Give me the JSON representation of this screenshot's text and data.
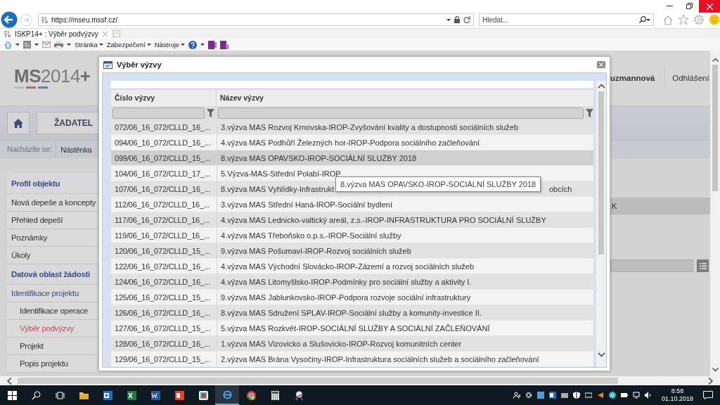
{
  "browser": {
    "url": "https://mseu.mssf.cz/",
    "search_placeholder": "Hledat...",
    "tab_title": "ISKP14+ : Výběr podvýzvy",
    "commands": [
      "Stránka",
      "Zabezpečení",
      "Nástroje"
    ]
  },
  "site": {
    "logo": "**MS**2014**+**",
    "user": "uzmannová",
    "logout": "Odhlášení",
    "role_button": "ŽADATEL",
    "breadcrumb": [
      "Nacházíte se:",
      "Nástěnka"
    ],
    "tab_fragment": "K",
    "sidebar": [
      {
        "label": "Profil objektu",
        "kind": "heading",
        "selected": false
      },
      {
        "label": "Nová depeše a koncepty",
        "kind": "item",
        "selected": false
      },
      {
        "label": "Přehled depeší",
        "kind": "item",
        "selected": false
      },
      {
        "label": "Poznámky",
        "kind": "item",
        "selected": false
      },
      {
        "label": "Úkoly",
        "kind": "item",
        "selected": false
      },
      {
        "label": "Datová oblast žádosti",
        "kind": "heading",
        "selected": false
      },
      {
        "label": "Identifikace projektu",
        "kind": "section",
        "selected": false
      },
      {
        "label": "Identifikace operace",
        "kind": "subitem",
        "selected": false
      },
      {
        "label": "Výběr podvýzvy",
        "kind": "subitem",
        "selected": true
      },
      {
        "label": "Projekt",
        "kind": "subitem",
        "selected": false
      },
      {
        "label": "Popis projektu",
        "kind": "subitem",
        "selected": false
      }
    ]
  },
  "dialog": {
    "title": "Výběr výzvy",
    "columns": [
      "Číslo výzvy",
      "Název výzvy"
    ],
    "tooltip": "8.výzva MAS OPAVSKO-IROP-SOCIÁLNÍ SLUŽBY 2018",
    "rows": [
      {
        "number": "072/06_16_072/CLLD_16_...",
        "name": "3.výzva MAS Rozvoj Krnovska-IROP-Zvyšování kvality a dostupnosti sociálních služeb",
        "selected": false
      },
      {
        "number": "094/06_16_072/CLLD_16_...",
        "name": "4.výzva MAS Podhůří Železných hor-IROP-Podpora sociálního začleňování",
        "selected": false
      },
      {
        "number": "099/06_16_072/CLLD_15_...",
        "name": "8.výzva MAS OPAVSKO-IROP-SOCIÁLNÍ SLUŽBY 2018",
        "selected": true
      },
      {
        "number": "104/06_16_072/CLLD_17_...",
        "name": "5.Výzva-MAS-Střední Polabí-IROP",
        "selected": false
      },
      {
        "number": "107/06_16_072/CLLD_16_...",
        "name": "8.výzva MAS Vyhlídky-Infrastrukt",
        "name_tail": "obcích",
        "selected": false
      },
      {
        "number": "112/06_16_072/CLLD_16_...",
        "name": "3.výzva MAS Střední Haná-IROP-Sociální bydlení",
        "selected": false
      },
      {
        "number": "117/06_16_072/CLLD_16_...",
        "name": "4.výzva MAS Lednicko-valtický areál, z.s.-IROP-INFRASTRUKTURA PRO SOCIÁLNÍ SLUŽBY",
        "selected": false
      },
      {
        "number": "119/06_16_072/CLLD_16_...",
        "name": "4.výzva MAS Třeboňsko o.p.s.-IROP-Sociální služby",
        "selected": false
      },
      {
        "number": "120/06_16_072/CLLD_15_...",
        "name": "9.výzva MAS Pošumaví-IROP-Rozvoj sociálních služeb",
        "selected": false
      },
      {
        "number": "122/06_16_072/CLLD_16_...",
        "name": "4.výzva MAS Východní Slovácko-IROP-Zázemí a rozvoj sociálních služeb",
        "selected": false
      },
      {
        "number": "124/06_16_072/CLLD_16_...",
        "name": "4.výzva MAS Litomyšlsko-IROP-Podmínky pro sociální služby a aktivity I.",
        "selected": false
      },
      {
        "number": "125/06_16_072/CLLD_15_...",
        "name": "9.výzva MAS Jablunkovsko-IROP-Podpora rozvoje sociální infrastruktury",
        "selected": false
      },
      {
        "number": "126/06_16_072/CLLD_16_...",
        "name": "8.výzva MAS Sdružení SPLAV-IROP-Sociální služby a komunity-investice II.",
        "selected": false
      },
      {
        "number": "127/06_16_072/CLLD_15_...",
        "name": "5.výzva MAS Rozkvět-IROP-SOCIÁLNÍ SLUŽBY A SOCIÁLNÍ ZAČLEŇOVÁNÍ",
        "selected": false
      },
      {
        "number": "128/06_16_072/CLLD_16_...",
        "name": "1.výzva MAS Vizovicko a Slušovicko-IROP-Rozvoj komunitních center",
        "selected": false
      },
      {
        "number": "129/06_16_072/CLLD_15_...",
        "name": "2.výzva MAS Brána Vysočiny-IROP-Infrastruktura sociálních služeb a sociálního začleňování",
        "selected": false
      }
    ]
  },
  "taskbar": {
    "time": "8:58",
    "date": "01.10.2018"
  }
}
